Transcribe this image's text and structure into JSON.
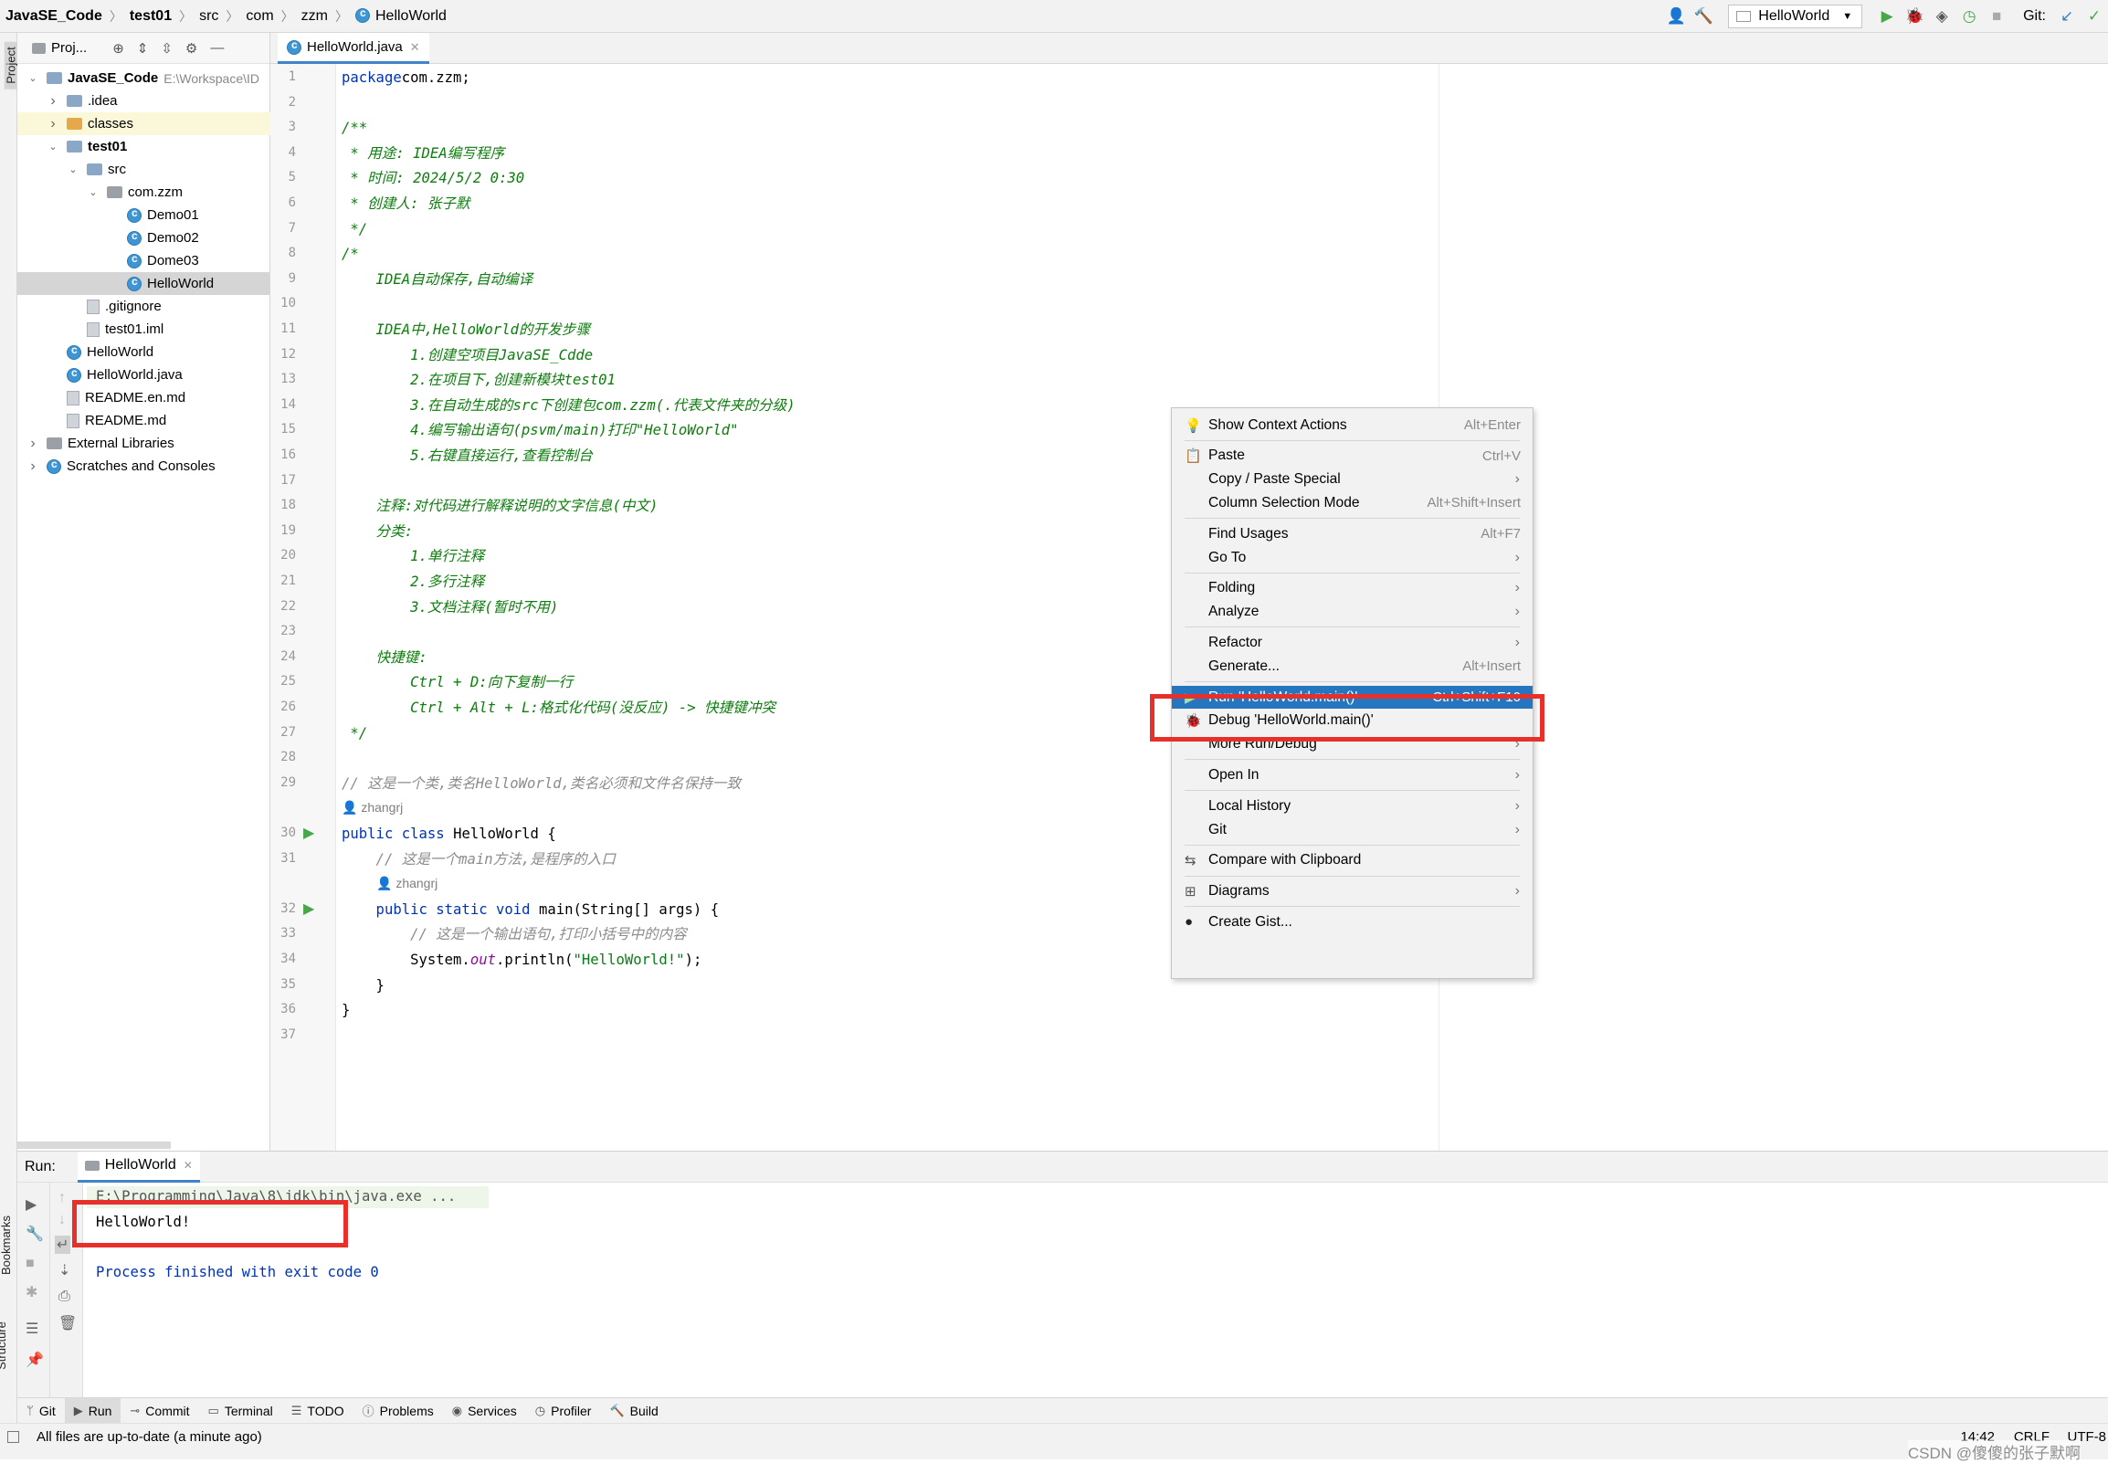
{
  "breadcrumb": [
    "JavaSE_Code",
    "test01",
    "src",
    "com",
    "zzm",
    "HelloWorld"
  ],
  "toolbar": {
    "run_config": "HelloWorld",
    "git_label": "Git:"
  },
  "left_strip": {
    "project": "Project",
    "bookmarks": "Bookmarks",
    "structure": "Structure"
  },
  "project_panel": {
    "title": "Proj...",
    "tree": [
      {
        "label": "JavaSE_Code",
        "extra": "E:\\Workspace\\ID",
        "depth": 0,
        "arrow": "down",
        "icon": "module",
        "bold": true
      },
      {
        "label": ".idea",
        "depth": 1,
        "arrow": "right",
        "icon": "folder"
      },
      {
        "label": "classes",
        "depth": 1,
        "arrow": "right",
        "icon": "folder-orange"
      },
      {
        "label": "test01",
        "depth": 1,
        "arrow": "down",
        "icon": "module",
        "bold": true
      },
      {
        "label": "src",
        "depth": 2,
        "arrow": "down",
        "icon": "folder"
      },
      {
        "label": "com.zzm",
        "depth": 3,
        "arrow": "down",
        "icon": "package"
      },
      {
        "label": "Demo01",
        "depth": 4,
        "icon": "class"
      },
      {
        "label": "Demo02",
        "depth": 4,
        "icon": "class"
      },
      {
        "label": "Dome03",
        "depth": 4,
        "icon": "class"
      },
      {
        "label": "HelloWorld",
        "depth": 4,
        "icon": "class",
        "selected": true
      },
      {
        "label": ".gitignore",
        "depth": 2,
        "icon": "file"
      },
      {
        "label": "test01.iml",
        "depth": 2,
        "icon": "file"
      },
      {
        "label": "HelloWorld",
        "depth": 1,
        "icon": "class"
      },
      {
        "label": "HelloWorld.java",
        "depth": 1,
        "icon": "java"
      },
      {
        "label": "README.en.md",
        "depth": 1,
        "icon": "md"
      },
      {
        "label": "README.md",
        "depth": 1,
        "icon": "md"
      },
      {
        "label": "External Libraries",
        "depth": 0,
        "arrow": "right",
        "icon": "lib"
      },
      {
        "label": "Scratches and Consoles",
        "depth": 0,
        "arrow": "right",
        "icon": "scratch"
      }
    ]
  },
  "editor": {
    "tab": "HelloWorld.java",
    "lines": [
      {
        "n": "1",
        "t": [
          [
            "kw",
            "package"
          ],
          [
            "",
            "com.zzm;"
          ]
        ]
      },
      {
        "n": "2",
        "t": []
      },
      {
        "n": "3",
        "t": [
          [
            "doc",
            "/**"
          ]
        ]
      },
      {
        "n": "4",
        "t": [
          [
            "doc",
            " * 用途: IDEA编写程序"
          ]
        ]
      },
      {
        "n": "5",
        "t": [
          [
            "doc",
            " * 时间: 2024/5/2 0:30"
          ]
        ]
      },
      {
        "n": "6",
        "t": [
          [
            "doc",
            " * 创建人: 张子默"
          ]
        ]
      },
      {
        "n": "7",
        "t": [
          [
            "doc",
            " */"
          ]
        ]
      },
      {
        "n": "8",
        "t": [
          [
            "doc",
            "/*"
          ]
        ]
      },
      {
        "n": "9",
        "t": [
          [
            "doc",
            "    IDEA自动保存,自动编译"
          ]
        ]
      },
      {
        "n": "10",
        "t": []
      },
      {
        "n": "11",
        "t": [
          [
            "doc",
            "    IDEA中,HelloWorld的开发步骤"
          ]
        ]
      },
      {
        "n": "12",
        "t": [
          [
            "doc",
            "        1.创建空项目JavaSE_Cdde"
          ]
        ]
      },
      {
        "n": "13",
        "t": [
          [
            "doc",
            "        2.在项目下,创建新模块test01"
          ]
        ]
      },
      {
        "n": "14",
        "t": [
          [
            "doc",
            "        3.在自动生成的src下创建包com.zzm(.代表文件夹的分级)"
          ]
        ]
      },
      {
        "n": "15",
        "t": [
          [
            "doc",
            "        4.编写输出语句(psvm/main)打印\"HelloWorld\""
          ]
        ]
      },
      {
        "n": "16",
        "t": [
          [
            "doc",
            "        5.右键直接运行,查看控制台"
          ]
        ]
      },
      {
        "n": "17",
        "t": []
      },
      {
        "n": "18",
        "t": [
          [
            "doc",
            "    注释:对代码进行解释说明的文字信息(中文)"
          ]
        ]
      },
      {
        "n": "19",
        "t": [
          [
            "doc",
            "    分类:"
          ]
        ]
      },
      {
        "n": "20",
        "t": [
          [
            "doc",
            "        1.单行注释"
          ]
        ]
      },
      {
        "n": "21",
        "t": [
          [
            "doc",
            "        2.多行注释"
          ]
        ]
      },
      {
        "n": "22",
        "t": [
          [
            "doc",
            "        3.文档注释(暂时不用)"
          ]
        ]
      },
      {
        "n": "23",
        "t": []
      },
      {
        "n": "24",
        "t": [
          [
            "doc",
            "    快捷键:"
          ]
        ]
      },
      {
        "n": "25",
        "t": [
          [
            "doc",
            "        Ctrl + D:向下复制一行"
          ]
        ]
      },
      {
        "n": "26",
        "t": [
          [
            "doc",
            "        Ctrl + Alt + L:格式化代码(没反应) -> 快捷键冲突"
          ]
        ]
      },
      {
        "n": "27",
        "t": [
          [
            "doc",
            " */"
          ]
        ]
      },
      {
        "n": "28",
        "t": []
      },
      {
        "n": "29",
        "t": [
          [
            "cm",
            "// 这是一个类,类名HelloWorld,类名必须和文件名保持一致"
          ]
        ]
      },
      {
        "hint": "zhangrj",
        "indent": 0
      },
      {
        "n": "30",
        "run": true,
        "t": [
          [
            "kw",
            "public class "
          ],
          [
            "",
            "HelloWorld {"
          ]
        ]
      },
      {
        "n": "31",
        "t": [
          [
            "cm",
            "    // 这是一个main方法,是程序的入口"
          ]
        ]
      },
      {
        "hint": "zhangrj",
        "indent": 1
      },
      {
        "n": "32",
        "run": true,
        "t": [
          [
            "kw",
            "    public static void "
          ],
          [
            "",
            "main(String[] args) {"
          ]
        ]
      },
      {
        "n": "33",
        "t": [
          [
            "cm",
            "        // 这是一个输出语句,打印小括号中的内容"
          ]
        ]
      },
      {
        "n": "34",
        "t": [
          [
            "",
            "        System."
          ],
          [
            "fld",
            "out"
          ],
          [
            "",
            ".println("
          ],
          [
            "str",
            "\"HelloWorld!\""
          ],
          [
            "",
            ");"
          ]
        ]
      },
      {
        "n": "35",
        "t": [
          [
            "",
            "    }"
          ]
        ]
      },
      {
        "n": "36",
        "t": [
          [
            "",
            "}"
          ]
        ]
      },
      {
        "n": "37",
        "t": []
      }
    ]
  },
  "context_menu": [
    {
      "label": "Show Context Actions",
      "shortcut": "Alt+Enter",
      "icon": "bulb-icon"
    },
    {
      "sep": true
    },
    {
      "label": "Paste",
      "shortcut": "Ctrl+V",
      "icon": "clipboard-icon"
    },
    {
      "label": "Copy / Paste Special",
      "submenu": true
    },
    {
      "label": "Column Selection Mode",
      "shortcut": "Alt+Shift+Insert"
    },
    {
      "sep": true
    },
    {
      "label": "Find Usages",
      "shortcut": "Alt+F7"
    },
    {
      "label": "Go To",
      "submenu": true
    },
    {
      "sep": true
    },
    {
      "label": "Folding",
      "submenu": true
    },
    {
      "label": "Analyze",
      "submenu": true
    },
    {
      "sep": true
    },
    {
      "label": "Refactor",
      "submenu": true
    },
    {
      "label": "Generate...",
      "shortcut": "Alt+Insert"
    },
    {
      "sep": true
    },
    {
      "label": "Run 'HelloWorld.main()'",
      "shortcut": "Ctrl+Shift+F10",
      "icon": "run-icon",
      "active": true
    },
    {
      "label": "Debug 'HelloWorld.main()'",
      "icon": "debug-icon"
    },
    {
      "label": "More Run/Debug",
      "submenu": true
    },
    {
      "sep": true
    },
    {
      "label": "Open In",
      "submenu": true
    },
    {
      "sep": true
    },
    {
      "label": "Local History",
      "submenu": true
    },
    {
      "label": "Git",
      "submenu": true
    },
    {
      "sep": true
    },
    {
      "label": "Compare with Clipboard",
      "icon": "compare-icon"
    },
    {
      "sep": true
    },
    {
      "label": "Diagrams",
      "submenu": true,
      "icon": "diagram-icon"
    },
    {
      "sep": true
    },
    {
      "label": "Create Gist...",
      "icon": "github-icon"
    }
  ],
  "run_panel": {
    "title": "Run:",
    "tab": "HelloWorld",
    "command": "E:\\Programming\\Java\\8\\jdk\\bin\\java.exe ...",
    "output": "HelloWorld!",
    "finished": "Process finished with exit code 0"
  },
  "bottom_tabs": [
    "Git",
    "Run",
    "Commit",
    "Terminal",
    "TODO",
    "Problems",
    "Services",
    "Profiler",
    "Build"
  ],
  "status": {
    "message": "All files are up-to-date (a minute ago)",
    "position": "14:42",
    "line_sep": "CRLF",
    "encoding": "UTF-8",
    "watermark": "CSDN @傻傻的张子默啊"
  },
  "colors": {
    "highlight_red": "#e8302a",
    "selection_blue": "#2675bf",
    "keyword": "#0033b3",
    "doc_comment": "#0d7d0d"
  }
}
